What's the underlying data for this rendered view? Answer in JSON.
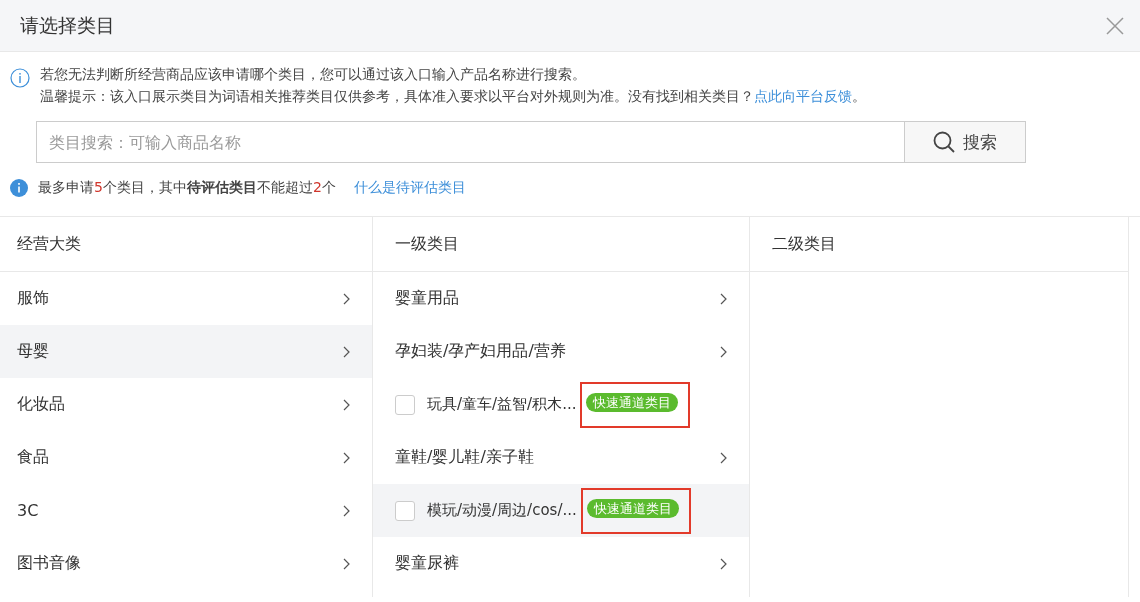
{
  "dialog": {
    "title": "请选择类目"
  },
  "info": {
    "line1": "若您无法判断所经营商品应该申请哪个类目，您可以通过该入口输入产品名称进行搜索。",
    "line2": "温馨提示：该入口展示类目为词语相关推荐类目仅供参考，具体准入要求以平台对外规则为准。没有找到相关类目？",
    "link": "点此向平台反馈",
    "tail": "。"
  },
  "search": {
    "placeholder": "类目搜索：可输入商品名称",
    "button": "搜索"
  },
  "note": {
    "segments": [
      {
        "kind": "plain",
        "text": "最多申请"
      },
      {
        "kind": "count",
        "text": "5"
      },
      {
        "kind": "plain",
        "text": "个类目，其中"
      },
      {
        "kind": "strong",
        "text": "待评估类目"
      },
      {
        "kind": "plain",
        "text": "不能超过"
      },
      {
        "kind": "count",
        "text": "2"
      },
      {
        "kind": "plain",
        "text": "个"
      }
    ],
    "link": "什么是待评估类目"
  },
  "columns": [
    "经营大类",
    "一级类目",
    "二级类目"
  ],
  "main_categories": [
    {
      "label": "服饰",
      "selected": false
    },
    {
      "label": "母婴",
      "selected": true
    },
    {
      "label": "化妆品",
      "selected": false
    },
    {
      "label": "食品",
      "selected": false
    },
    {
      "label": "3C",
      "selected": false
    },
    {
      "label": "图书音像",
      "selected": false
    }
  ],
  "level1_categories": [
    {
      "kind": "category",
      "label": "婴童用品",
      "selected": false
    },
    {
      "kind": "category",
      "label": "孕妇装/孕产妇用品/营养",
      "selected": false
    },
    {
      "kind": "checkbox",
      "label": "玩具/童车/益智/积木...",
      "badge": "快速通道类目",
      "checked": false,
      "selected": false
    },
    {
      "kind": "category",
      "label": "童鞋/婴儿鞋/亲子鞋",
      "selected": false
    },
    {
      "kind": "checkbox",
      "label": "模玩/动漫/周边/cos/...",
      "badge": "快速通道类目",
      "checked": false,
      "selected": true
    },
    {
      "kind": "category",
      "label": "婴童尿裤",
      "selected": false
    }
  ]
}
